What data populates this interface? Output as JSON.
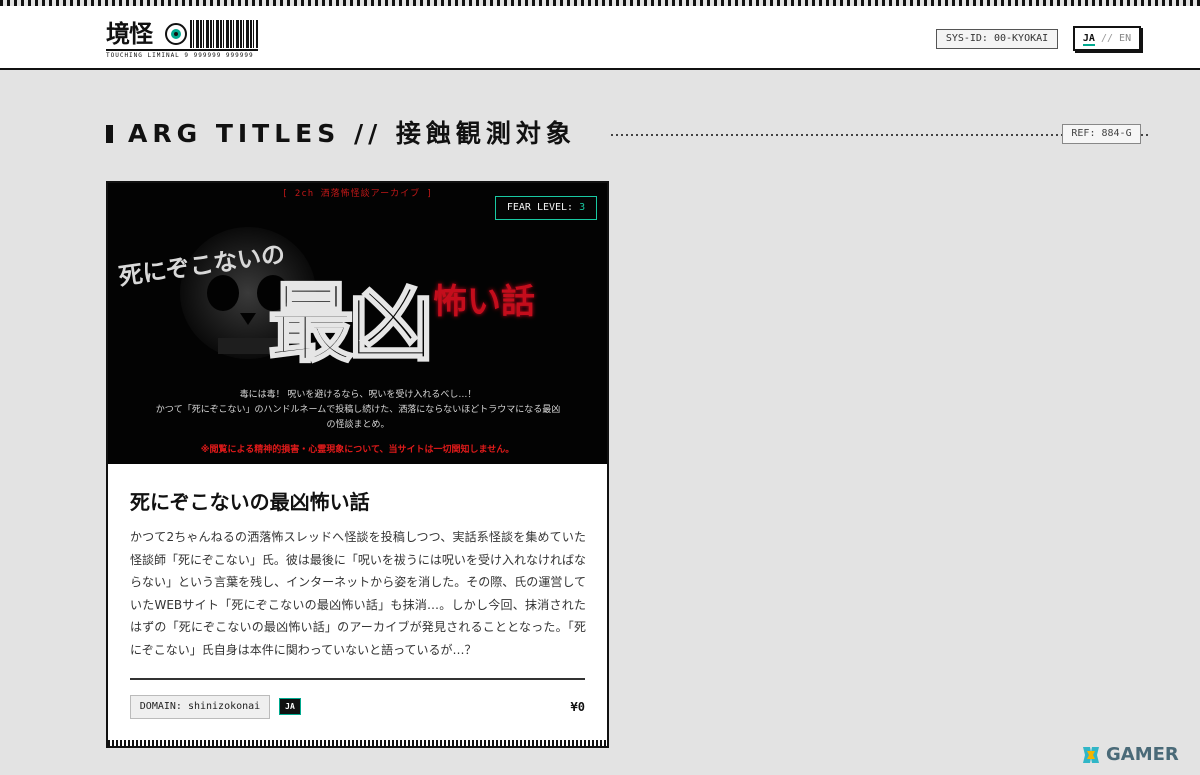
{
  "header": {
    "logo_kanji": "境怪",
    "logo_sub": "TOUCHING LIMINAL 9 999999 999999",
    "sys_id": "SYS-ID: 00-KYOKAI",
    "lang_ja": "JA",
    "lang_sep": " // ",
    "lang_en": "EN"
  },
  "section": {
    "title": "ARG TITLES // 接蝕観測対象",
    "ref": "REF: 884-G"
  },
  "card": {
    "image": {
      "top_label": "[ 2ch 洒落怖怪談アーカイブ ]",
      "fear_label": "FEAR LEVEL:",
      "fear_level": "3",
      "art_line1": "死にぞこないの",
      "art_big": "最凶",
      "art_red": "怖い話",
      "subtext_line1": "毒には毒！ 呪いを避けるなら、呪いを受け入れるべし…！",
      "subtext_line2": "かつて「死にぞこない」のハンドルネームで投稿し続けた、洒落にならないほどトラウマになる最凶",
      "subtext_line3": "の怪談まとめ。",
      "warning": "※閲覧による精神的損害・心霊現象について、当サイトは一切関知しません。"
    },
    "title": "死にぞこないの最凶怖い話",
    "description": "かつて2ちゃんねるの洒落怖スレッドへ怪談を投稿しつつ、実話系怪談を集めていた怪談師「死にぞこない」氏。彼は最後に「呪いを祓うには呪いを受け入れなければならない」という言葉を残し、インターネットから姿を消した。その際、氏の運営していたWEBサイト「死にぞこないの最凶怖い話」も抹消…。しかし今回、抹消されたはずの「死にぞこないの最凶怖い話」のアーカイブが発見されることとなった。「死にぞこない」氏自身は本件に関わっていないと語っているが…？",
    "domain": "DOMAIN: shinizokonai",
    "lang_badge": "JA",
    "price": "¥0"
  },
  "watermark": {
    "text": "GAMER"
  },
  "colors": {
    "accent": "#00a98f",
    "fear_teal": "#19c9a2",
    "warning_red": "#e01a1a",
    "background": "#e3e3e3"
  }
}
